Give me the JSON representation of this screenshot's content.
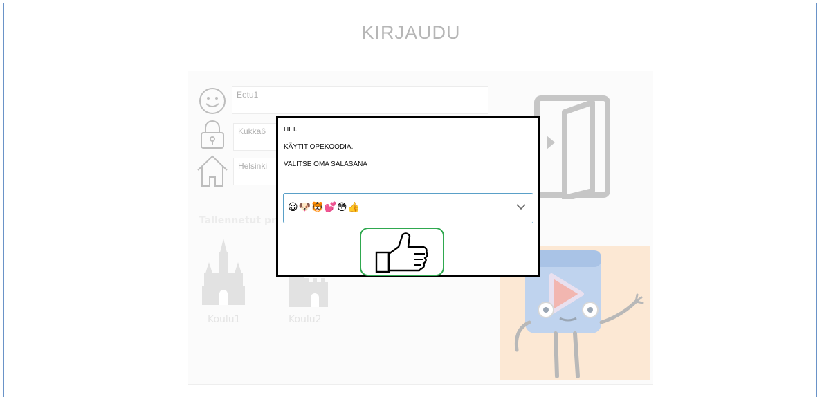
{
  "page": {
    "title": "KIRJAUDU"
  },
  "login": {
    "username": {
      "value": "Eetu1",
      "icon": "smiley-icon"
    },
    "password": {
      "value": "Kukka6",
      "icon": "lock-icon"
    },
    "school": {
      "value": "Helsinki",
      "icon": "house-icon"
    }
  },
  "saved_profiles": {
    "label": "Tallennetut profiilit",
    "items": [
      {
        "label": "Koulu1",
        "icon": "castle-icon"
      },
      {
        "label": "Koulu2",
        "icon": "tower-icon"
      }
    ]
  },
  "dialog": {
    "line1": "HEI.",
    "line2": "KÄYTIT OPEKOODIA.",
    "line3": "VALITSE OMA SALASANA",
    "password_select": {
      "value": "😀🐶🐯💕😳👍"
    },
    "ok_button": {
      "icon": "thumbs-up-icon"
    }
  },
  "colors": {
    "frame": "#6a93c8",
    "dialog_border": "#000000",
    "select_border": "#5aa0c8",
    "ok_border": "#2fa84f",
    "mascot_bg": "#fce8d4"
  }
}
